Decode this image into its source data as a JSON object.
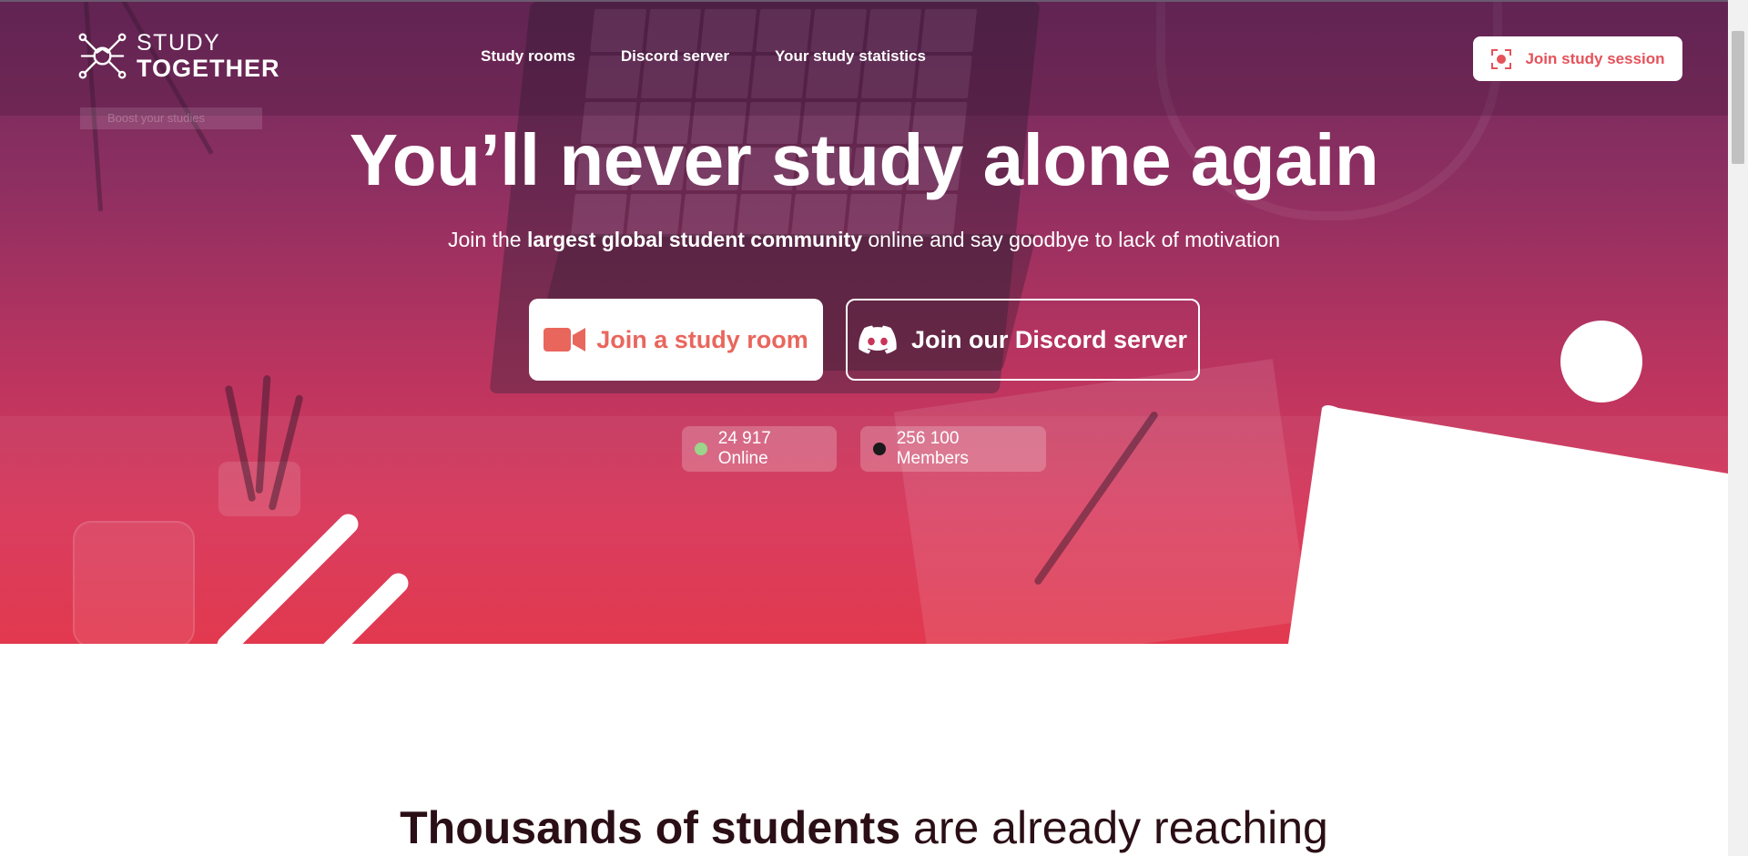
{
  "brand": {
    "line1": "STUDY",
    "line2": "TOGETHER"
  },
  "nav": {
    "items": [
      {
        "label": "Study rooms"
      },
      {
        "label": "Discord server"
      },
      {
        "label": "Your study statistics"
      }
    ],
    "cta_label": "Join study session"
  },
  "ghost_label": "Boost your studies",
  "hero": {
    "headline": "You’ll never study alone again",
    "sub_prefix": "Join the ",
    "sub_bold": "largest global student community",
    "sub_suffix": " online and say goodbye to lack of motivation",
    "btn_room": "Join a study room",
    "btn_discord": "Join our Discord server"
  },
  "stats": {
    "online": "24 917 Online",
    "members": "256 100 Members",
    "online_color": "#9bd48a",
    "members_color": "#1a1a1a"
  },
  "section": {
    "title_bold": "Thousands of students",
    "title_rest": " are already reaching"
  },
  "colors": {
    "accent": "#e9665d",
    "hero_top": "#6e2a5e",
    "hero_bottom": "#e2394f"
  },
  "icons": [
    "logo-network-icon",
    "record-icon",
    "video-camera-icon",
    "discord-icon"
  ]
}
